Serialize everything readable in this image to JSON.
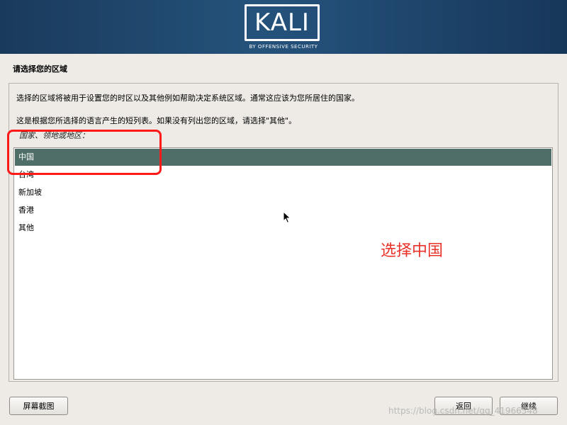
{
  "header": {
    "logo_text": "KALI",
    "logo_subtitle": "BY OFFENSIVE SECURITY"
  },
  "page": {
    "title": "请选择您的区域",
    "description_1": "选择的区域将被用于设置您的时区以及其他例如帮助决定系统区域。通常这应该为您所居住的国家。",
    "description_2": "这是根据您所选择的语言产生的短列表。如果没有列出您的区域，请选择\"其他\"。",
    "list_label": "国家、领地或地区："
  },
  "region_list": {
    "selected": "中国",
    "items": [
      "中国",
      "台湾",
      "新加坡",
      "香港",
      "其他"
    ]
  },
  "annotation": {
    "text": "选择中国",
    "color": "#e8322a"
  },
  "buttons": {
    "screenshot": "屏幕截图",
    "back": "返回",
    "continue": "继续"
  },
  "watermark": "https://blog.csdn.net/qq_41966548",
  "colors": {
    "selected_row": "#4f6e68",
    "header_blue": "#24527a",
    "annotation_red": "#ff1a1a"
  }
}
